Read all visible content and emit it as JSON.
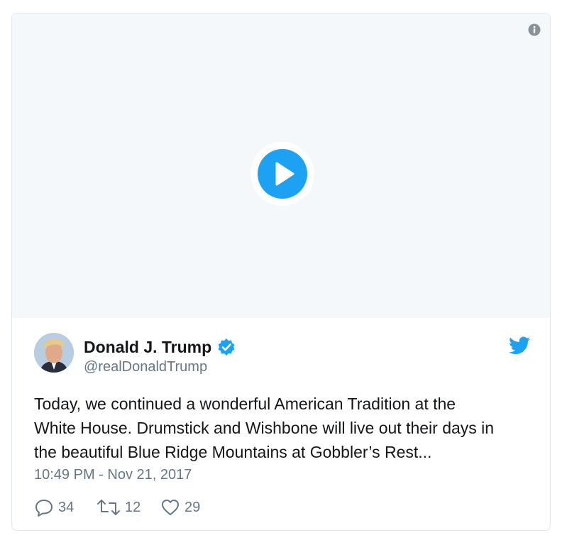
{
  "tweet": {
    "author_name": "Donald J. Trump",
    "handle": "@realDonaldTrump",
    "text_lines": [
      "Today, we continued a wonderful American Tradition at the",
      "White House. Drumstick and Wishbone will live out their days in",
      "the beautiful Blue Ridge Mountains at Gobbler’s Rest..."
    ],
    "timestamp": "10:49 PM - Nov 21, 2017",
    "replies": "34",
    "retweets": "12",
    "likes": "29"
  },
  "icons": {
    "info": "info-icon",
    "play": "play-icon",
    "verified": "verified-badge-icon",
    "brand": "twitter-bird-icon",
    "reply": "reply-icon",
    "retweet": "retweet-icon",
    "like": "heart-icon"
  },
  "colors": {
    "accent": "#1da1f2",
    "media_bg": "#f5f8fa",
    "text": "#14171a",
    "muted": "#657786",
    "border": "#e1e8ed"
  }
}
